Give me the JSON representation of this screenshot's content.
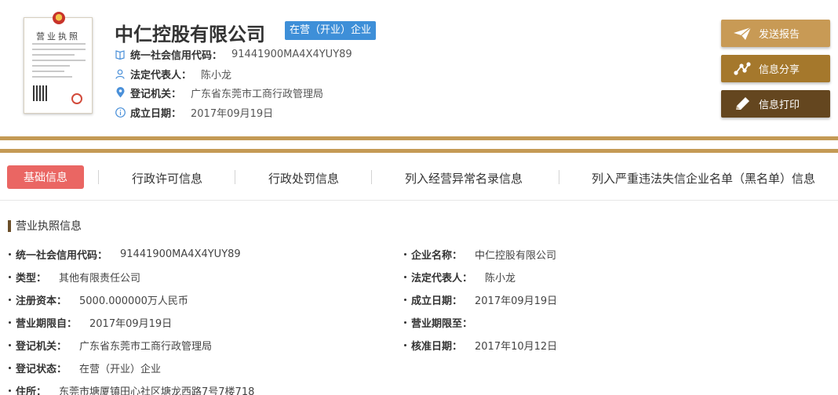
{
  "license": {
    "title": "营业执照"
  },
  "company": {
    "name": "中仁控股有限公司",
    "status": "在营（开业）企业",
    "credit_code_label": "统一社会信用代码：",
    "credit_code": "91441900MA4X4YUY89",
    "legal_rep_label": "法定代表人：",
    "legal_rep": "陈小龙",
    "authority_label": "登记机关：",
    "authority": "广东省东莞市工商行政管理局",
    "founded_label": "成立日期：",
    "founded": "2017年09月19日"
  },
  "actions": {
    "send": "发送报告",
    "share": "信息分享",
    "print": "信息打印"
  },
  "tabs": [
    {
      "label": "基础信息",
      "active": true
    },
    {
      "label": "行政许可信息"
    },
    {
      "label": "行政处罚信息"
    },
    {
      "label": "列入经营异常名录信息"
    },
    {
      "label": "列入严重违法失信企业名单（黑名单）信息"
    }
  ],
  "section": {
    "title": "营业执照信息",
    "fields_left": [
      {
        "label": "统一社会信用代码：",
        "value": "91441900MA4X4YUY89"
      },
      {
        "label": "类型：",
        "value": "其他有限责任公司"
      },
      {
        "label": "注册资本：",
        "value": "5000.000000万人民币"
      },
      {
        "label": "营业期限自：",
        "value": "2017年09月19日"
      },
      {
        "label": "登记机关：",
        "value": "广东省东莞市工商行政管理局"
      },
      {
        "label": "登记状态：",
        "value": "在营（开业）企业"
      },
      {
        "label": "住所：",
        "value": "东莞市塘厦镇田心社区塘龙西路7号7楼718"
      }
    ],
    "fields_right": [
      {
        "label": "企业名称：",
        "value": "中仁控股有限公司"
      },
      {
        "label": "法定代表人：",
        "value": "陈小龙"
      },
      {
        "label": "成立日期：",
        "value": "2017年09月19日"
      },
      {
        "label": "营业期限至：",
        "value": ""
      },
      {
        "label": "核准日期：",
        "value": "2017年10月12日"
      }
    ]
  },
  "colors": {
    "gold": "#c49a55",
    "tab_active": "#ea6663",
    "status_tag": "#3e8fd8",
    "btn_send": "#c89a55",
    "btn_share": "#a5782c",
    "btn_print": "#64461f"
  },
  "icons": [
    "book-icon",
    "user-icon",
    "location-pin-icon",
    "info-icon",
    "paper-plane-icon",
    "share-icon",
    "pencil-icon"
  ]
}
